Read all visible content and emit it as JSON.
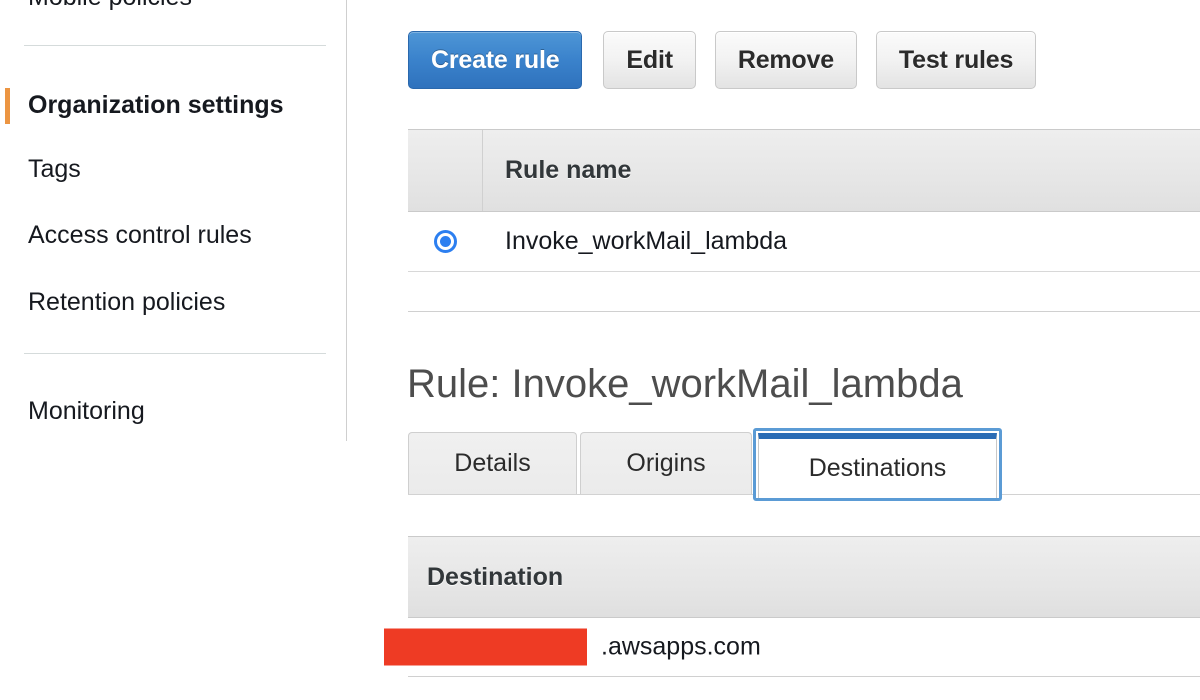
{
  "sidebar": {
    "items": [
      {
        "label": "Mobile policies",
        "active": false,
        "clipped": true
      },
      {
        "label": "Organization settings",
        "active": true,
        "clipped": false
      },
      {
        "label": "Tags",
        "active": false,
        "clipped": false
      },
      {
        "label": "Access control rules",
        "active": false,
        "clipped": false
      },
      {
        "label": "Retention policies",
        "active": false,
        "clipped": false
      },
      {
        "label": "Monitoring",
        "active": false,
        "clipped": false
      }
    ],
    "active_marker_color": "#ec9542"
  },
  "toolbar": {
    "create_rule_label": "Create rule",
    "edit_label": "Edit",
    "remove_label": "Remove",
    "test_rules_label": "Test rules",
    "primary_color": "#3b83cc"
  },
  "rules_table": {
    "columns": [
      "",
      "Rule name"
    ],
    "header_rule_name": "Rule name",
    "rows": [
      {
        "selected": true,
        "rule_name": "Invoke_workMail_lambda"
      }
    ],
    "radio_color": "#2c7ff0"
  },
  "rule_detail": {
    "heading": "Rule: Invoke_workMail_lambda",
    "tabs": [
      {
        "label": "Details",
        "active": false
      },
      {
        "label": "Origins",
        "active": false
      },
      {
        "label": "Destinations",
        "active": true
      }
    ],
    "active_tab_accent": "#2a6cb5",
    "focus_ring_color": "#5b9bd5"
  },
  "destinations_table": {
    "header_destination": "Destination",
    "rows": [
      {
        "redacted": true,
        "value": ".awsapps.com"
      }
    ],
    "redaction_color": "#ee3b24"
  }
}
